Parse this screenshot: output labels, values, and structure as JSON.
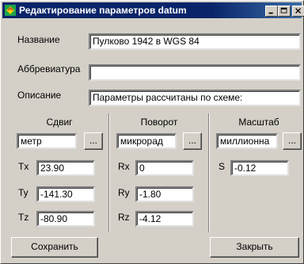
{
  "window": {
    "title": "Редактирование параметров datum",
    "controls": {
      "minimize_icon": "minimize-icon",
      "maximize_icon": "maximize-icon",
      "close_icon": "close-icon"
    }
  },
  "form": {
    "name": {
      "label": "Название",
      "value": "Пулково 1942 в WGS 84"
    },
    "abbreviation": {
      "label": "Аббревиатура",
      "value": ""
    },
    "description": {
      "label": "Описание",
      "value": "Параметры рассчитаны по схеме:"
    }
  },
  "groups": {
    "shift": {
      "title": "Сдвиг",
      "unit": "метр",
      "browse_label": "...",
      "params": [
        {
          "label": "Tx",
          "value": "23.90"
        },
        {
          "label": "Ty",
          "value": "-141.30"
        },
        {
          "label": "Tz",
          "value": "-80.90"
        }
      ]
    },
    "rotation": {
      "title": "Поворот",
      "unit": "микрорад",
      "browse_label": "...",
      "params": [
        {
          "label": "Rx",
          "value": "0"
        },
        {
          "label": "Ry",
          "value": "-1.80"
        },
        {
          "label": "Rz",
          "value": "-4.12"
        }
      ]
    },
    "scale": {
      "title": "Масштаб",
      "unit": "миллионна",
      "browse_label": "...",
      "params": [
        {
          "label": "S",
          "value": "-0.12"
        }
      ]
    }
  },
  "buttons": {
    "save": "Сохранить",
    "close": "Закрыть"
  }
}
